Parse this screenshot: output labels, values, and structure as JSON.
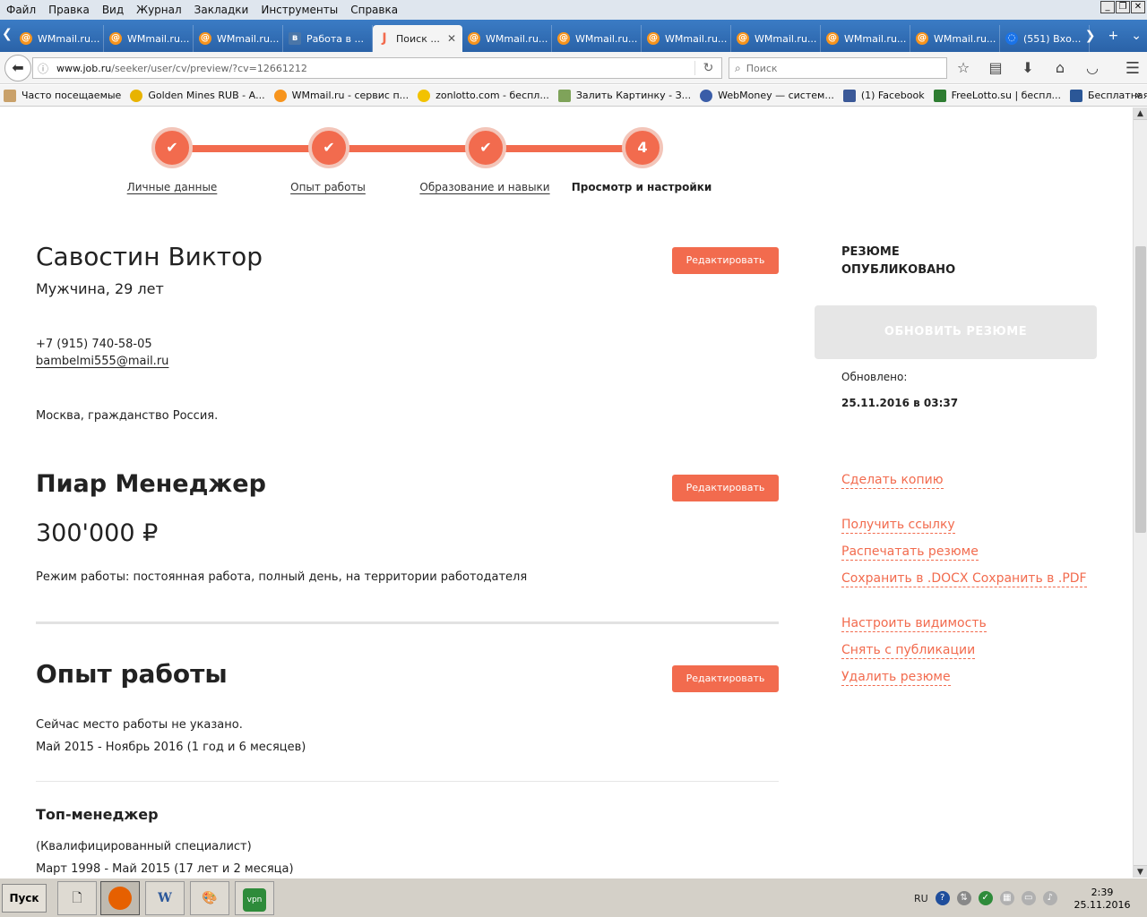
{
  "menu": [
    "Файл",
    "Правка",
    "Вид",
    "Журнал",
    "Закладки",
    "Инструменты",
    "Справка"
  ],
  "tabs": [
    {
      "label": "WMmail.ru...",
      "icon": "@"
    },
    {
      "label": "WMmail.ru...",
      "icon": "@"
    },
    {
      "label": "WMmail.ru...",
      "icon": "@"
    },
    {
      "label": "Работа в ...",
      "icon": "vk"
    },
    {
      "label": "Поиск ...",
      "icon": "J",
      "active": true
    },
    {
      "label": "WMmail.ru...",
      "icon": "@"
    },
    {
      "label": "WMmail.ru...",
      "icon": "@"
    },
    {
      "label": "WMmail.ru...",
      "icon": "@"
    },
    {
      "label": "WMmail.ru...",
      "icon": "@"
    },
    {
      "label": "WMmail.ru...",
      "icon": "@"
    },
    {
      "label": "WMmail.ru...",
      "icon": "@"
    },
    {
      "label": "(551) Вхо...",
      "icon": "o"
    }
  ],
  "nav": {
    "url_host": "www.job.ru",
    "url_path": "/seeker/user/cv/preview/?cv=12661212",
    "search_placeholder": "Поиск"
  },
  "bookmarks": [
    "Часто посещаемые",
    "Golden Mines RUB - А...",
    "WMmail.ru - сервис п...",
    "zonlotto.com - беспл...",
    "Залить Картинку - З...",
    "WebMoney — систем...",
    "(1) Facebook",
    "FreeLotto.su | беспл...",
    "Бесплатная консуль..."
  ],
  "steps": [
    {
      "label": "Личные данные",
      "mark": "✔"
    },
    {
      "label": "Опыт работы",
      "mark": "✔"
    },
    {
      "label": "Образование и навыки",
      "mark": "✔"
    },
    {
      "label": "Просмотр и настройки",
      "mark": "4"
    }
  ],
  "resume": {
    "name": "Савостин Виктор",
    "gender_age": "Мужчина, 29 лет",
    "phone": "+7 (915) 740-58-05",
    "email": "bambelmi555@mail.ru",
    "city": "Москва, гражданство Россия.",
    "position": "Пиар Менеджер",
    "salary": "300'000 ₽",
    "work_mode": "Режим работы: постоянная работа, полный день, на территории работодателя",
    "edit_label": "Редактировать"
  },
  "experience": {
    "title": "Опыт работы",
    "current": "Сейчас место работы не указано.",
    "current_period": "Май 2015 - Ноябрь 2016 (1 год и 6 месяцев)",
    "job_title": "Топ-менеджер",
    "job_level": "(Квалифицированный специалист)",
    "job_period": "Март 1998 - Май 2015 (17 лет и 2 месяца)"
  },
  "sidebar": {
    "status": "РЕЗЮМЕ ОПУБЛИКОВАНО",
    "update_button": "ОБНОВИТЬ РЕЗЮМЕ",
    "updated_label": "Обновлено:",
    "updated_value": "25.11.2016 в 03:37",
    "links": {
      "copy": "Сделать копию",
      "get_link": "Получить ссылку",
      "print": "Распечатать резюме",
      "save": "Сохранить в .DOCX Сохранить в .PDF",
      "visibility": "Настроить видимость",
      "unpublish": "Снять с публикации",
      "delete": "Удалить резюме"
    }
  },
  "taskbar": {
    "start": "Пуск",
    "lang": "RU",
    "time": "2:39",
    "date": "25.11.2016"
  },
  "colors": {
    "accent": "#f26b4e",
    "tabbar": "#2d6bb3",
    "update_button": "#e6e6e6"
  }
}
